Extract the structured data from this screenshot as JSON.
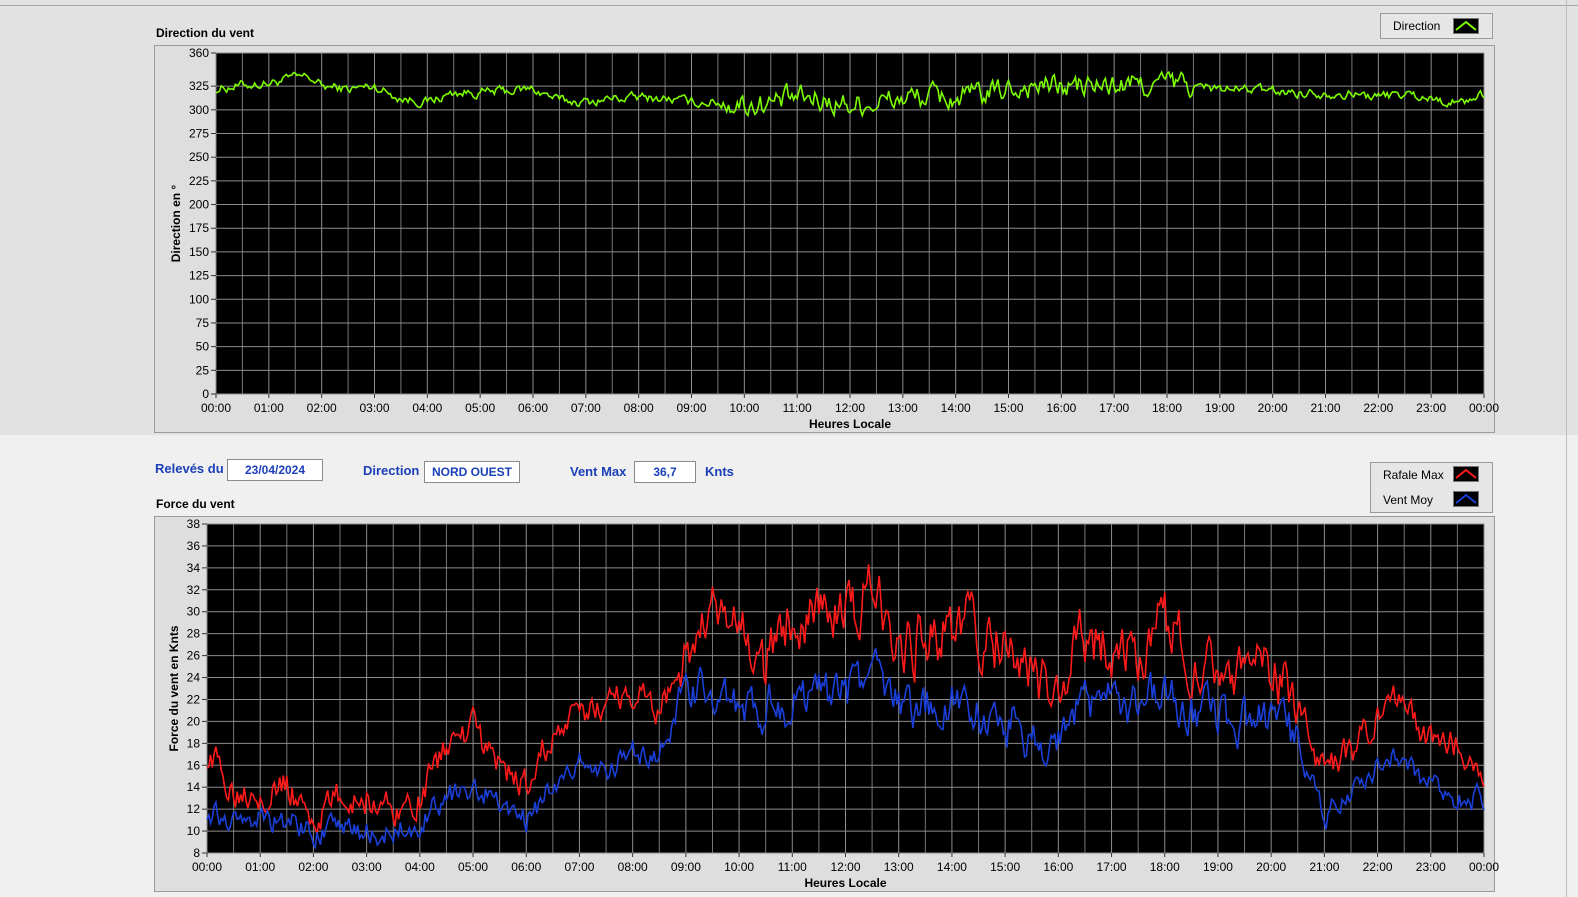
{
  "colors": {
    "plot_bg": "#000000",
    "grid": "#8c8c8c",
    "direction": "#7cfc00",
    "gust": "#ff1a1a",
    "avg": "#1a3fd8",
    "info_text": "#1a3fb8"
  },
  "info": {
    "date_label": "Relevés du",
    "date_value": "23/04/2024",
    "direction_label": "Direction",
    "direction_value": "NORD OUEST",
    "vmax_label": "Vent Max",
    "vmax_value": "36,7",
    "vmax_unit": "Knts"
  },
  "chart_data": [
    {
      "id": "direction",
      "type": "line",
      "title": "Direction du vent",
      "xlabel": "Heures Locale",
      "ylabel": "Direction en °",
      "x_ticks": [
        "00:00",
        "01:00",
        "02:00",
        "03:00",
        "04:00",
        "05:00",
        "06:00",
        "07:00",
        "08:00",
        "09:00",
        "10:00",
        "11:00",
        "12:00",
        "13:00",
        "14:00",
        "15:00",
        "16:00",
        "17:00",
        "18:00",
        "19:00",
        "20:00",
        "21:00",
        "22:00",
        "23:00",
        "00:00"
      ],
      "y_ticks": [
        0,
        25,
        50,
        75,
        100,
        125,
        150,
        175,
        200,
        225,
        250,
        275,
        300,
        325,
        360
      ],
      "ylim": [
        0,
        360
      ],
      "xlim": [
        0,
        24
      ],
      "grid": true,
      "legend": {
        "position": "top-right",
        "entries": [
          "Direction"
        ]
      },
      "series": [
        {
          "name": "Direction",
          "color": "#7cfc00",
          "x": [
            0,
            0.5,
            1,
            1.5,
            1.75,
            2,
            2.5,
            3,
            3.5,
            4,
            4.5,
            5,
            5.5,
            6,
            6.5,
            7,
            7.5,
            8,
            8.5,
            9,
            9.5,
            10,
            10.5,
            11,
            11.5,
            12,
            12.5,
            13,
            13.5,
            14,
            14.5,
            15,
            15.5,
            16,
            16.5,
            17,
            17.5,
            18,
            18.5,
            19,
            19.5,
            20,
            20.5,
            21,
            21.5,
            22,
            22.5,
            23,
            23.5,
            24
          ],
          "values": [
            322,
            326,
            328,
            334,
            335,
            325,
            322,
            325,
            312,
            308,
            318,
            318,
            320,
            322,
            310,
            308,
            312,
            313,
            312,
            308,
            308,
            306,
            307,
            312,
            310,
            306,
            308,
            312,
            314,
            312,
            315,
            322,
            326,
            324,
            325,
            325,
            326,
            328,
            326,
            322,
            322,
            320,
            318,
            318,
            317,
            314,
            317,
            312,
            307,
            316
          ]
        }
      ]
    },
    {
      "id": "force",
      "type": "line",
      "title": "Force du vent",
      "xlabel": "Heures Locale",
      "ylabel": "Force du vent en Knts",
      "x_ticks": [
        "00:00",
        "01:00",
        "02:00",
        "03:00",
        "04:00",
        "05:00",
        "06:00",
        "07:00",
        "08:00",
        "09:00",
        "10:00",
        "11:00",
        "12:00",
        "13:00",
        "14:00",
        "15:00",
        "16:00",
        "17:00",
        "18:00",
        "19:00",
        "20:00",
        "21:00",
        "22:00",
        "23:00",
        "00:00"
      ],
      "y_ticks": [
        8,
        10,
        12,
        14,
        16,
        18,
        20,
        22,
        24,
        26,
        28,
        30,
        32,
        34,
        36,
        38
      ],
      "ylim": [
        8,
        38
      ],
      "xlim": [
        0,
        24
      ],
      "grid": true,
      "legend": {
        "position": "top-right",
        "entries": [
          "Rafale Max",
          "Vent Moy"
        ]
      },
      "series": [
        {
          "name": "Rafale Max",
          "color": "#ff1a1a",
          "x": [
            0,
            0.5,
            1,
            1.5,
            2,
            2.5,
            3,
            3.5,
            4,
            4.5,
            5,
            5.5,
            6,
            6.5,
            7,
            7.5,
            8,
            8.5,
            9,
            9.5,
            10,
            10.5,
            11,
            11.5,
            12,
            12.5,
            13,
            13.5,
            14,
            14.5,
            15,
            15.5,
            16,
            16.5,
            17,
            17.5,
            18,
            18.5,
            19,
            19.5,
            20,
            20.5,
            21,
            21.5,
            22,
            22.5,
            23,
            23.5,
            24
          ],
          "values": [
            17,
            14,
            14,
            14,
            11,
            13,
            13,
            12,
            13,
            18,
            19,
            16,
            14,
            19,
            20,
            22,
            23,
            21,
            26,
            29,
            28,
            25,
            30,
            31,
            29,
            32,
            28,
            27,
            29,
            28,
            27,
            24,
            22,
            28,
            27,
            26,
            29,
            26,
            26,
            24,
            24,
            22,
            15,
            17,
            20,
            22,
            18,
            18,
            16
          ]
        },
        {
          "name": "Vent Moy",
          "color": "#1a3fd8",
          "x": [
            0,
            0.5,
            1,
            1.5,
            2,
            2.5,
            3,
            3.5,
            4,
            4.5,
            5,
            5.5,
            6,
            6.5,
            7,
            7.5,
            8,
            8.5,
            9,
            9.5,
            10,
            10.5,
            11,
            11.5,
            12,
            12.5,
            13,
            13.5,
            14,
            14.5,
            15,
            15.5,
            16,
            16.5,
            17,
            17.5,
            18,
            18.5,
            19,
            19.5,
            20,
            20.5,
            21,
            21.5,
            22,
            22.5,
            23,
            23.5,
            24
          ],
          "values": [
            12,
            11,
            11,
            11,
            10,
            10,
            10,
            10,
            11,
            13,
            14,
            13,
            11,
            14,
            16,
            16,
            17,
            17,
            22,
            23,
            22,
            21,
            22,
            23,
            22,
            24,
            22,
            21,
            22,
            21,
            20,
            19,
            18,
            22,
            22,
            21,
            23,
            21,
            21,
            20,
            20,
            18,
            11,
            14,
            16,
            17,
            14,
            13,
            13
          ]
        }
      ]
    }
  ]
}
